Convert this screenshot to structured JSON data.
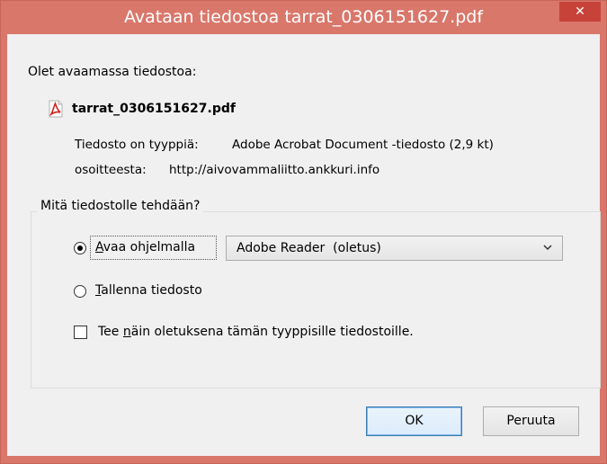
{
  "window": {
    "title": "Avataan tiedostoa tarrat_0306151627.pdf",
    "close_glyph": "✕",
    "accent": "#d9776b"
  },
  "file": {
    "intro": "Olet avaamassa tiedostoa:",
    "icon": "pdf-file-icon",
    "name": "tarrat_0306151627.pdf",
    "type_label": "Tiedosto on tyyppiä:",
    "type_value": "Adobe Acrobat Document -tiedosto (2,9 kt)",
    "source_label": "osoitteesta:",
    "source_value": "http://aivovammaliitto.ankkuri.info"
  },
  "action": {
    "legend": "Mitä tiedostolle tehdään?",
    "open_with": {
      "accel": "A",
      "rest": "vaa ohjelmalla",
      "checked": true
    },
    "app_select": {
      "value": "Adobe Reader  (oletus)"
    },
    "save": {
      "accel": "T",
      "rest": "allenna tiedosto",
      "checked": false
    },
    "default_checkbox": {
      "pre": "Tee ",
      "accel": "n",
      "rest": "äin oletuksena tämän tyyppisille tiedostoille.",
      "checked": false
    }
  },
  "buttons": {
    "ok": "OK",
    "cancel": "Peruuta"
  }
}
